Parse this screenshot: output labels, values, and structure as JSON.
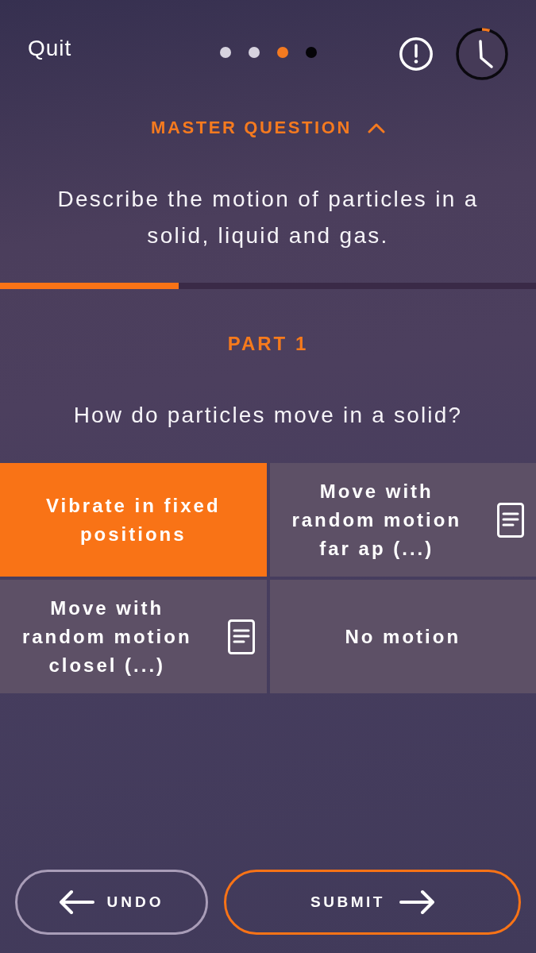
{
  "header": {
    "quit": "Quit",
    "pagination": [
      {
        "selected": false,
        "answered": true
      },
      {
        "selected": false,
        "answered": true
      },
      {
        "selected": true,
        "answered": false
      },
      {
        "selected": false,
        "answered": false
      }
    ],
    "timer": {
      "level": 0.05
    }
  },
  "master_question": {
    "label": "MASTER QUESTION",
    "expanded": true,
    "text": "Describe the motion of particles in a solid, liquid and gas."
  },
  "progress": {
    "level": 0.333
  },
  "part": {
    "label": "PART 1",
    "question": "How do particles move in a solid?"
  },
  "options": [
    {
      "text": "Vibrate in fixed positions",
      "selected": true,
      "has_note": false
    },
    {
      "text": "Move with random motion far ap (...)",
      "selected": false,
      "has_note": true
    },
    {
      "text": "Move with random motion closel (...)",
      "selected": false,
      "has_note": true
    },
    {
      "text": "No motion",
      "selected": false,
      "has_note": false
    }
  ],
  "buttons": {
    "undo": "UNDO",
    "submit": "SUBMIT"
  }
}
